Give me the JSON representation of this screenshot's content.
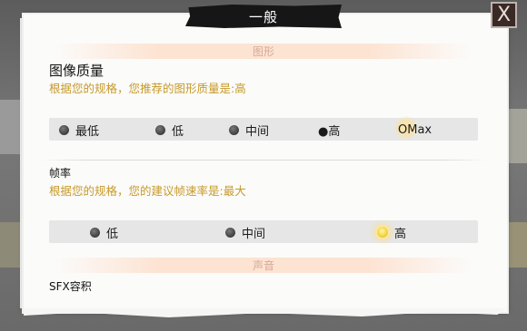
{
  "dialog": {
    "title": "一般",
    "close_label": "X"
  },
  "graphics_section": {
    "banner": "图形",
    "quality": {
      "heading": "图像质量",
      "hint": "根据您的规格，您推荐的图形质量是:高",
      "options": [
        {
          "label": "最低",
          "selected": false
        },
        {
          "label": "低",
          "selected": false
        },
        {
          "label": "中间",
          "selected": false
        },
        {
          "label": "●高",
          "selected": false
        },
        {
          "label": "OMax",
          "selected": true
        }
      ]
    },
    "framerate": {
      "heading": "帧率",
      "hint": "根据您的规格，您的建议帧速率是:最大",
      "options": [
        {
          "label": "低",
          "selected": false
        },
        {
          "label": "中间",
          "selected": false
        },
        {
          "label": "高",
          "selected": true
        }
      ]
    }
  },
  "sound_section": {
    "banner": "声音",
    "sfx_label": "SFX容积"
  },
  "colors": {
    "hint": "#c79a2a",
    "banner_text": "#d6a99a",
    "selected_glow": "#f2d33a"
  }
}
